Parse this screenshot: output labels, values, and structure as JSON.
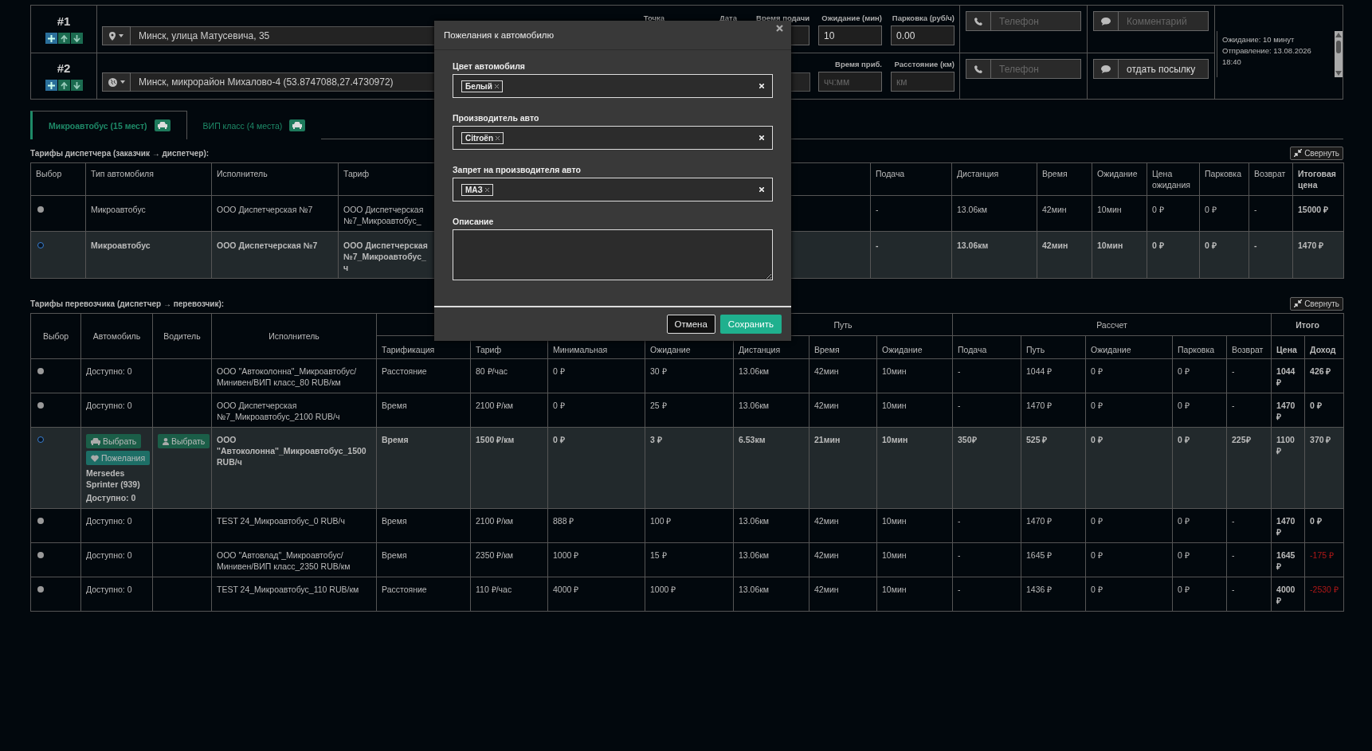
{
  "stops": [
    {
      "number": "#1",
      "kind": "address",
      "address": "Минск, улица Матусевича, 35",
      "fields": [
        {
          "label": "Точка",
          "kind": "label_only"
        },
        {
          "label": "Дата",
          "kind": "label_only"
        },
        {
          "label": "Время подачи",
          "kind": "input"
        },
        {
          "label": "Ожидание (мин)",
          "value": "10",
          "kind": "input"
        },
        {
          "label": "Парковка (руб/ч)",
          "value": "0.00",
          "kind": "input"
        }
      ],
      "phone": {
        "placeholder": "Телефон"
      },
      "comment": {
        "placeholder": "Комментарий"
      }
    },
    {
      "number": "#2",
      "kind": "coordinates",
      "address": "Минск, микрорайон Михалово-4 (53.8747088,27.4730972)",
      "fields": [
        {
          "label": "Время приб.",
          "placeholder": "чч:мм",
          "kind": "input"
        },
        {
          "label": "Расстояние (км)",
          "placeholder": "км",
          "kind": "input"
        }
      ],
      "phone": {
        "placeholder": "Телефон"
      },
      "comment": {
        "value": "отдать посылку"
      }
    }
  ],
  "trip_info": [
    "Ожидание: 10 минут",
    "Отправление: 13.08.2026 18:40"
  ],
  "tabs": [
    {
      "label": "Микроавтобус (15 мест)",
      "selected": true
    },
    {
      "label": "ВИП класс (4 места)",
      "selected": false
    }
  ],
  "dispatcher_table": {
    "title": "Тарифы диспетчера (заказчик → диспетчер):",
    "collapse_button": "Свернуть",
    "select_column": "Выбор",
    "columns": [
      "Тип автомобиля",
      "Исполнитель",
      "Тариф",
      "Подача",
      "Дистанция",
      "Время",
      "Ожидание",
      "Цена ожидания",
      "Парковка",
      "Возврат",
      "Итоговая цена"
    ],
    "rows": [
      {
        "selected": false,
        "cells": [
          "Микроавтобус",
          "ООО Диспетчерская №7",
          "ООО Диспетчерская\n№7_Микроавтобус_",
          "-",
          "13.06км",
          "42мин",
          "10мин",
          "0 ₽",
          "0 ₽",
          "-",
          "15000 ₽"
        ]
      },
      {
        "selected": true,
        "cells": [
          "Микроавтобус",
          "ООО Диспетчерская №7",
          "ООО Диспетчерская\n№7_Микроавтобус_\nч",
          "-",
          "13.06км",
          "42мин",
          "10мин",
          "0 ₽",
          "0 ₽",
          "-",
          "1470 ₽"
        ]
      }
    ]
  },
  "carrier_table": {
    "title": "Тарифы перевозчика (диспетчер → перевозчик):",
    "collapse_button": "Свернуть",
    "groups": [
      "Путь",
      "Рассчет",
      "Итого"
    ],
    "fixed_columns": [
      "Выбор",
      "Автомобиль",
      "Водитель"
    ],
    "columns": [
      "Исполнитель",
      "Тарификация",
      "Тариф",
      "Минимальная",
      "Ожидание",
      "Дистанция",
      "Время",
      "Ожидание",
      "Подача",
      "Путь",
      "Ожидание",
      "Парковка",
      "Возврат",
      "Цена",
      "Доход"
    ],
    "rows": [
      {
        "selected": false,
        "loss": false,
        "available": "Доступно: 0",
        "cells": [
          "ООО \"Автоколонна\"_Микроавтобус/Минивен/ВИП класс_80 RUB/км",
          "Расстояние",
          "80 ₽/час",
          "0 ₽",
          "30 ₽",
          "13.06км",
          "42мин",
          "10мин",
          "-",
          "1044 ₽",
          "0 ₽",
          "0 ₽",
          "-",
          "1044 ₽",
          "426 ₽"
        ]
      },
      {
        "selected": false,
        "loss": false,
        "available": "Доступно: 0",
        "cells": [
          "ООО Диспетчерская №7_Микроавтобус_2100 RUB/ч",
          "Время",
          "2100 ₽/км",
          "0 ₽",
          "25 ₽",
          "13.06км",
          "42мин",
          "10мин",
          "-",
          "1470 ₽",
          "0 ₽",
          "0 ₽",
          "-",
          "1470 ₽",
          "0 ₽"
        ]
      },
      {
        "selected": true,
        "loss": false,
        "choose_vehicle": "Выбрать",
        "wishes": "Пожелания",
        "vehicle": "Mersedes Sprinter (939)",
        "available": "Доступно: 0",
        "choose_driver": "Выбрать",
        "cells": [
          "ООО \"Автоколонна\"_Микроавтобус_1500 RUB/ч",
          "Время",
          "1500 ₽/км",
          "0 ₽",
          "3 ₽",
          "6.53км",
          "21мин",
          "10мин",
          "350₽",
          "525 ₽",
          "0 ₽",
          "0 ₽",
          "225₽",
          "1100 ₽",
          "370 ₽"
        ]
      },
      {
        "selected": false,
        "loss": false,
        "available": "Доступно: 0",
        "cells": [
          "TEST 24_Микроавтобус_0 RUB/ч",
          "Время",
          "2100 ₽/км",
          "888 ₽",
          "100 ₽",
          "13.06км",
          "42мин",
          "10мин",
          "-",
          "1470 ₽",
          "0 ₽",
          "0 ₽",
          "-",
          "1470 ₽",
          "0 ₽"
        ]
      },
      {
        "selected": false,
        "loss": true,
        "available": "Доступно: 0",
        "cells": [
          "ООО \"Автовлад\"_Микроавтобус/Минивен/ВИП класс_2350 RUB/км",
          "Время",
          "2350 ₽/км",
          "1000 ₽",
          "15 ₽",
          "13.06км",
          "42мин",
          "10мин",
          "-",
          "1645 ₽",
          "0 ₽",
          "0 ₽",
          "-",
          "1645 ₽",
          "-175 ₽"
        ]
      },
      {
        "selected": false,
        "loss": true,
        "available": "Доступно: 0",
        "cells": [
          "TEST 24_Микроавтобус_110 RUB/км",
          "Расстояние",
          "110 ₽/час",
          "4000 ₽",
          "1000 ₽",
          "13.06км",
          "42мин",
          "10мин",
          "-",
          "1436 ₽",
          "0 ₽",
          "0 ₽",
          "-",
          "4000 ₽",
          "-2530 ₽"
        ]
      }
    ]
  },
  "modal": {
    "title": "Пожелания к автомобилю",
    "fields": [
      {
        "kind": "tags",
        "label": "Цвет автомобиля",
        "tags": [
          "Белый"
        ]
      },
      {
        "kind": "tags",
        "label": "Производитель авто",
        "tags": [
          "Citroën"
        ]
      },
      {
        "kind": "tags",
        "label": "Запрет на производителя авто",
        "tags": [
          "МАЗ"
        ]
      },
      {
        "kind": "textarea",
        "label": "Описание"
      }
    ],
    "buttons": [
      {
        "kind": "cancel",
        "label": "Отмена"
      },
      {
        "kind": "primary",
        "label": "Сохранить"
      }
    ]
  }
}
